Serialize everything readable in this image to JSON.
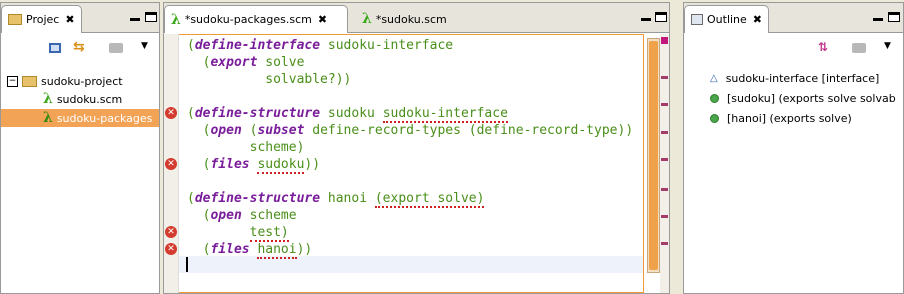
{
  "project_explorer": {
    "tab_label": "Projec",
    "tab_close": "✖",
    "tree": [
      {
        "label": "sudoku-project",
        "expander": "−"
      },
      {
        "label": "sudoku.scm"
      },
      {
        "label": "sudoku-packages"
      }
    ]
  },
  "editor": {
    "tabs": [
      {
        "label": "*sudoku-packages.scm",
        "close": "✖"
      },
      {
        "label": "*sudoku.scm"
      }
    ],
    "lines": [
      [
        {
          "k": "(",
          "c": "p"
        },
        {
          "k": "define-interface",
          "c": "kw"
        },
        {
          "k": " sudoku-interface",
          "c": "p"
        }
      ],
      [
        {
          "k": "  (",
          "c": "p"
        },
        {
          "k": "export",
          "c": "kw"
        },
        {
          "k": " solve",
          "c": "p"
        }
      ],
      [
        {
          "k": "          solvable?))",
          "c": "p"
        }
      ],
      [
        {
          "k": "",
          "c": "p"
        }
      ],
      [
        {
          "k": "(",
          "c": "p"
        },
        {
          "k": "define-structure",
          "c": "kw"
        },
        {
          "k": " sudoku ",
          "c": "p"
        },
        {
          "k": "sudoku-interface",
          "c": "err"
        }
      ],
      [
        {
          "k": "  (",
          "c": "p"
        },
        {
          "k": "open",
          "c": "kw"
        },
        {
          "k": " (",
          "c": "p"
        },
        {
          "k": "subset",
          "c": "kw"
        },
        {
          "k": " define-record-types (define-record-type))",
          "c": "p"
        }
      ],
      [
        {
          "k": "        scheme)",
          "c": "p"
        }
      ],
      [
        {
          "k": "  (",
          "c": "p"
        },
        {
          "k": "files",
          "c": "kw"
        },
        {
          "k": " ",
          "c": "p"
        },
        {
          "k": "sudoku",
          "c": "err"
        },
        {
          "k": "))",
          "c": "p"
        }
      ],
      [
        {
          "k": "",
          "c": "p"
        }
      ],
      [
        {
          "k": "(",
          "c": "p"
        },
        {
          "k": "define-structure",
          "c": "kw"
        },
        {
          "k": " hanoi ",
          "c": "p"
        },
        {
          "k": "(export solve)",
          "c": "err"
        }
      ],
      [
        {
          "k": "  (",
          "c": "p"
        },
        {
          "k": "open",
          "c": "kw"
        },
        {
          "k": " scheme",
          "c": "p"
        }
      ],
      [
        {
          "k": "        ",
          "c": "p"
        },
        {
          "k": "test)",
          "c": "err"
        }
      ],
      [
        {
          "k": "  (",
          "c": "p"
        },
        {
          "k": "files",
          "c": "kw"
        },
        {
          "k": " ",
          "c": "p"
        },
        {
          "k": "hanoi",
          "c": "err"
        },
        {
          "k": "))",
          "c": "p"
        }
      ]
    ],
    "error_icon": "✕"
  },
  "outline": {
    "tab_label": "Outline",
    "tab_close": "✖",
    "items": [
      {
        "label": "sudoku-interface [interface]",
        "icon": "interface-triangle-icon"
      },
      {
        "label": "[sudoku] (exports solve solvab",
        "icon": "structure-dot-icon"
      },
      {
        "label": "[hanoi] (exports solve)",
        "icon": "structure-dot-icon"
      }
    ]
  },
  "colors": {
    "selection": "#f3a355",
    "keyword": "#7a1d9a",
    "code": "#4a8f1a",
    "error": "#d43b2f"
  }
}
